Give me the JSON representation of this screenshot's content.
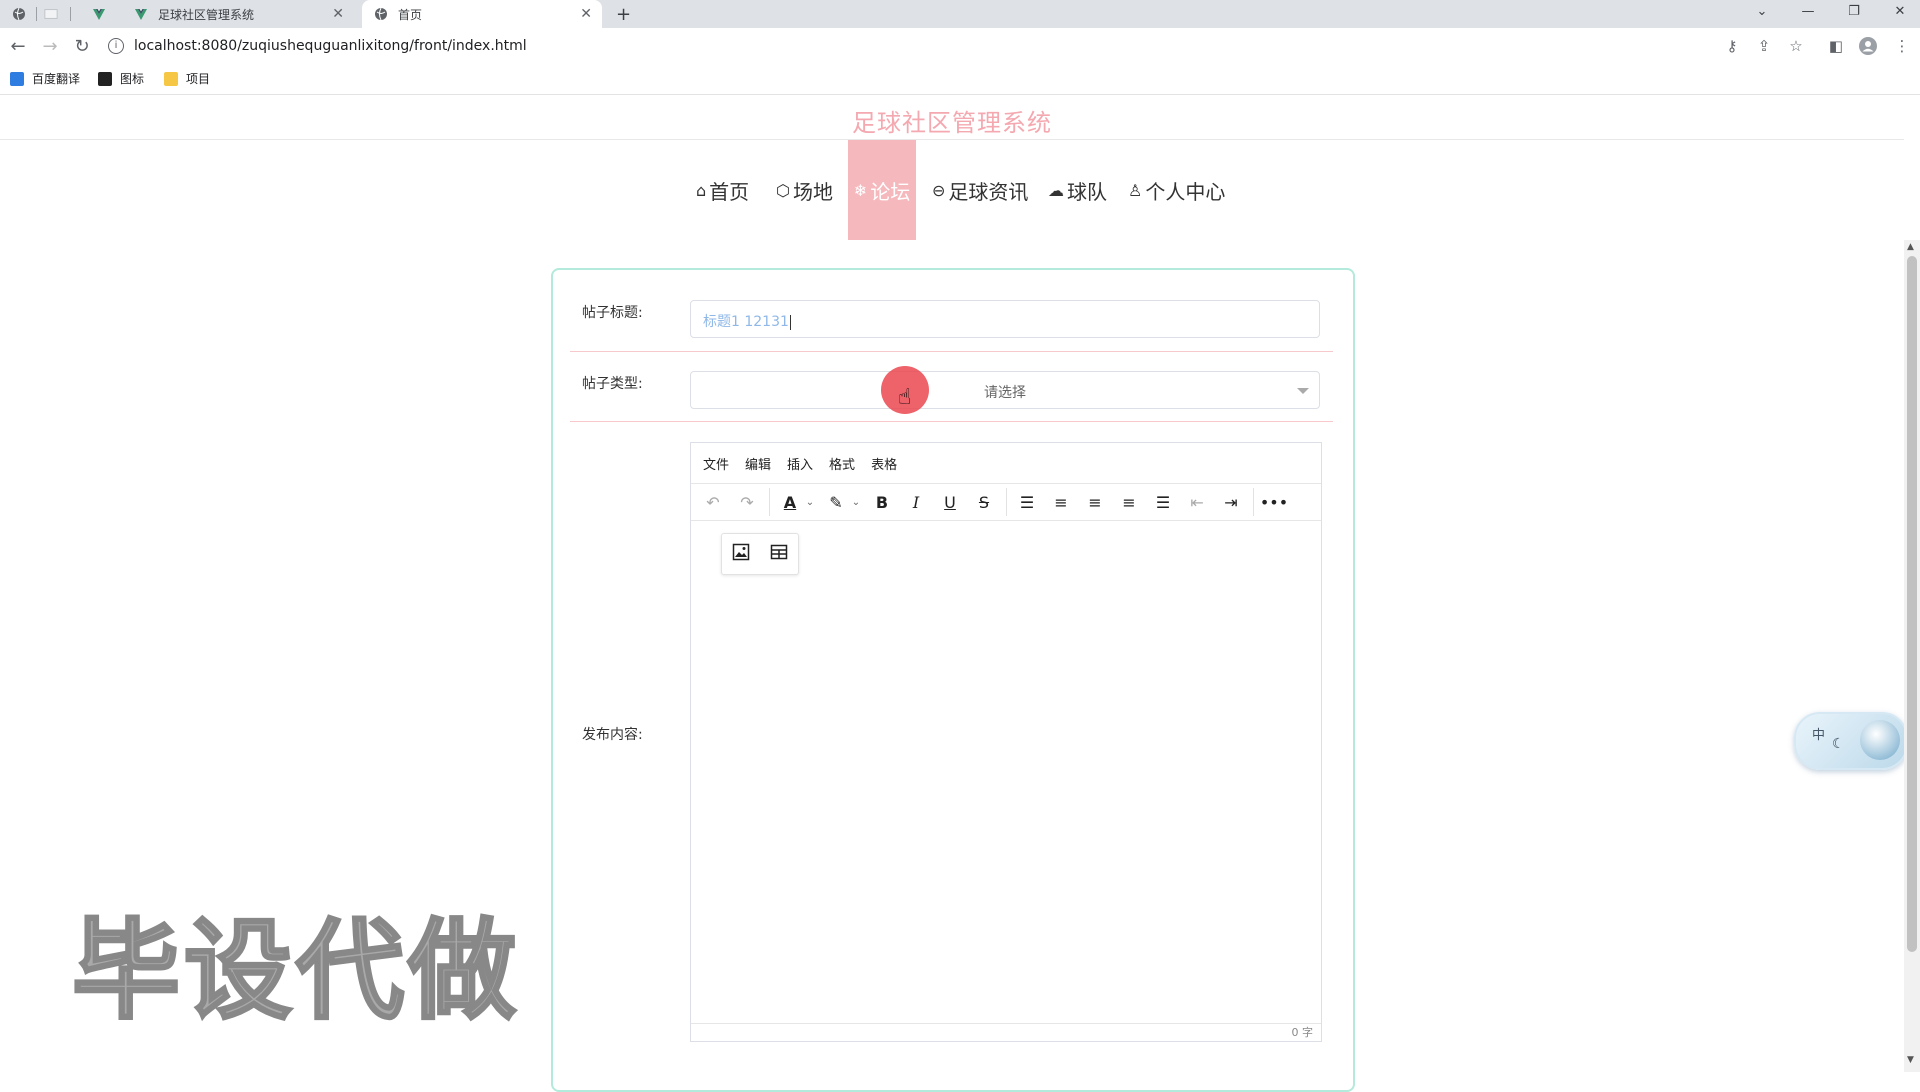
{
  "browser": {
    "tabs": [
      {
        "title": "",
        "icon": "globe-icon"
      },
      {
        "title": "",
        "icon": "blank-icon"
      },
      {
        "title": "",
        "icon": "vue-icon"
      },
      {
        "title": "足球社区管理系统",
        "icon": "vue-icon"
      },
      {
        "title": "首页",
        "icon": "globe-icon"
      }
    ],
    "new_tab": "+",
    "url": "localhost:8080/zuqiushequguanlixitong/front/index.html",
    "bookmarks": [
      {
        "label": "百度翻译",
        "color": "#2f7de1"
      },
      {
        "label": "图标",
        "color": "#222222"
      },
      {
        "label": "项目",
        "color": "#f6c744"
      }
    ]
  },
  "site": {
    "title": "足球社区管理系统",
    "title_color": "#f4a8b0",
    "accent_color": "#f5b8bd",
    "nav": [
      {
        "label": "首页",
        "icon": "home-icon",
        "glyph": "⌂"
      },
      {
        "label": "场地",
        "icon": "cube-icon",
        "glyph": "⬡"
      },
      {
        "label": "论坛",
        "icon": "snowflake-icon",
        "glyph": "❄",
        "active": true
      },
      {
        "label": "足球资讯",
        "icon": "football-icon",
        "glyph": "⊖"
      },
      {
        "label": "球队",
        "icon": "cloud-icon",
        "glyph": "☁"
      },
      {
        "label": "个人中心",
        "icon": "user-icon",
        "glyph": "♙"
      }
    ]
  },
  "form": {
    "title_label": "帖子标题:",
    "title_value": "标题1 12131",
    "type_label": "帖子类型:",
    "type_placeholder": "请选择",
    "content_label": "发布内容:",
    "editor": {
      "menus": [
        "文件",
        "编辑",
        "插入",
        "格式",
        "表格"
      ],
      "word_count": "0 字"
    }
  },
  "overlay": {
    "watermark": "毕设代做",
    "float_widget_text": "中"
  }
}
